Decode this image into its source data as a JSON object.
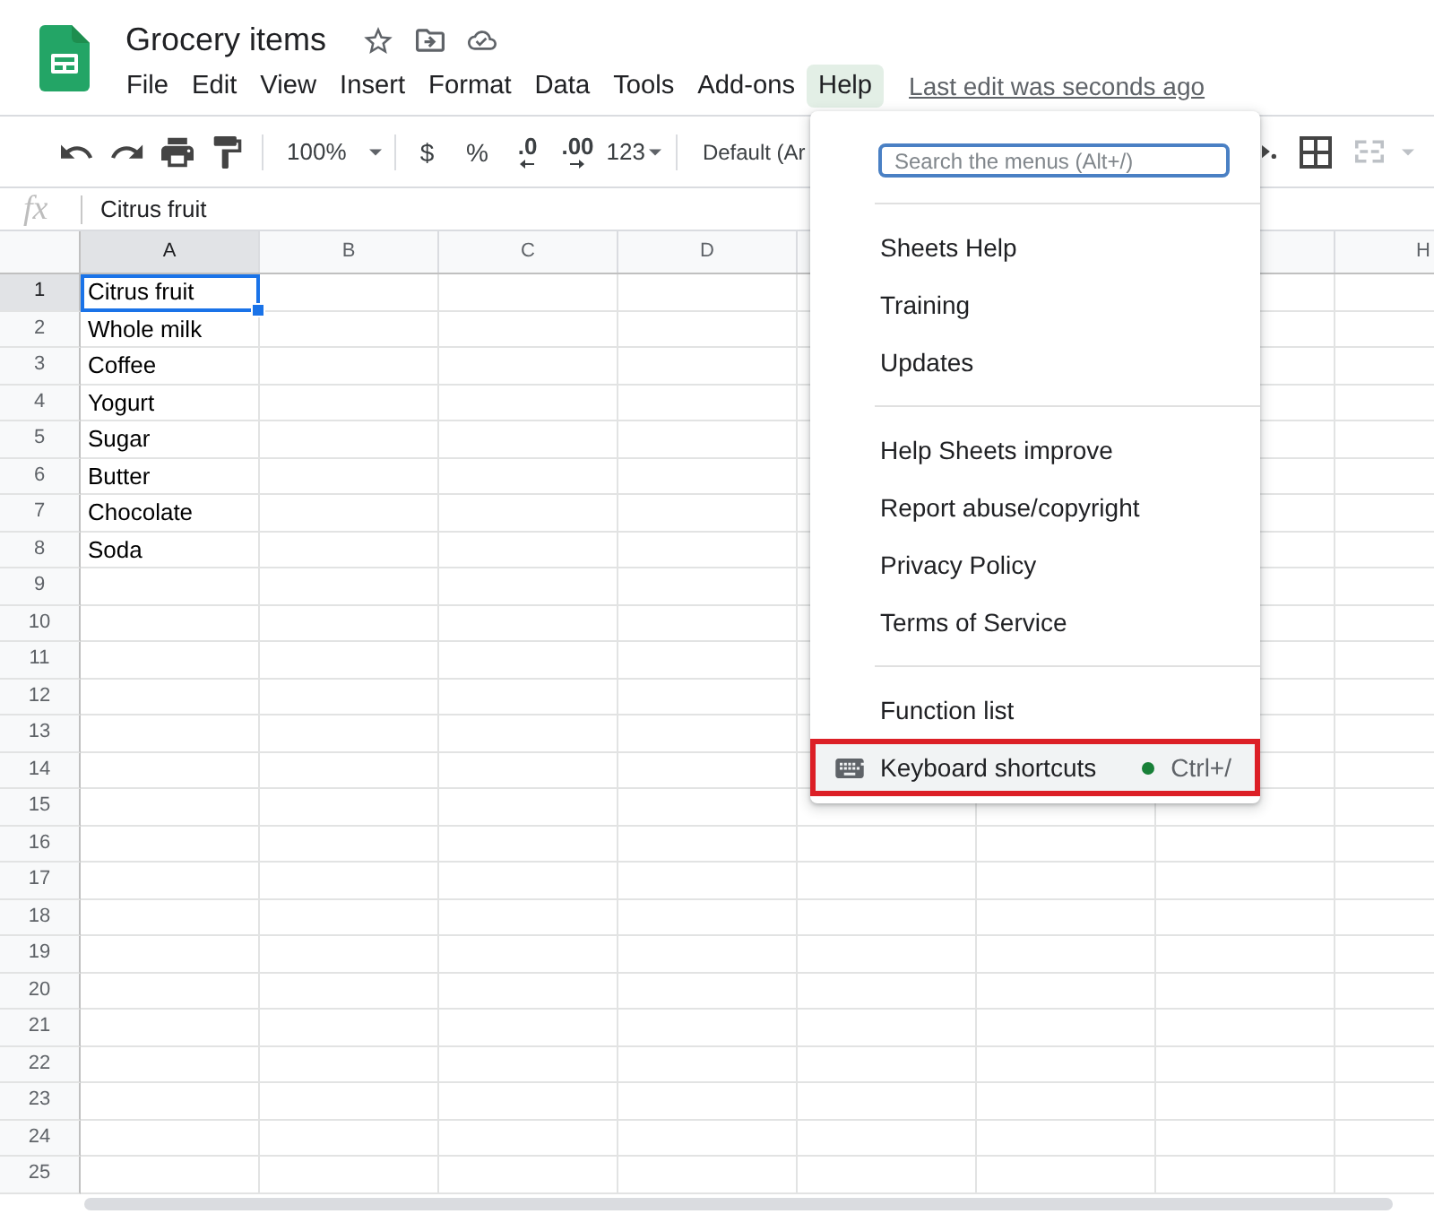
{
  "document": {
    "title": "Grocery items"
  },
  "menubar": {
    "items": [
      {
        "label": "File",
        "selected": false
      },
      {
        "label": "Edit",
        "selected": false
      },
      {
        "label": "View",
        "selected": false
      },
      {
        "label": "Insert",
        "selected": false
      },
      {
        "label": "Format",
        "selected": false
      },
      {
        "label": "Data",
        "selected": false
      },
      {
        "label": "Tools",
        "selected": false
      },
      {
        "label": "Add-ons",
        "selected": false
      },
      {
        "label": "Help",
        "selected": true
      }
    ],
    "last_edit": "Last edit was seconds ago"
  },
  "toolbar": {
    "zoom": "100%",
    "currency": "$",
    "percent": "%",
    "decrease_decimals": ".0",
    "increase_decimals": ".00",
    "number_format": "123",
    "font": "Default (Ar",
    "merge_disabled": true
  },
  "formula_bar": {
    "label": "fx",
    "value": "Citrus fruit"
  },
  "grid": {
    "columns": [
      {
        "label": "A",
        "selected": true
      },
      {
        "label": "B",
        "selected": false
      },
      {
        "label": "C",
        "selected": false
      },
      {
        "label": "D",
        "selected": false
      },
      {},
      {},
      {},
      {
        "label": "H",
        "selected": false
      }
    ],
    "rows": [
      {
        "label": "1",
        "selected": true,
        "cells": [
          {
            "text": "Citrus fruit",
            "selected": true
          }
        ]
      },
      {
        "label": "2",
        "selected": false,
        "cells": [
          {
            "text": "Whole milk",
            "selected": false
          }
        ]
      },
      {
        "label": "3",
        "selected": false,
        "cells": [
          {
            "text": "Coffee",
            "selected": false
          }
        ]
      },
      {
        "label": "4",
        "selected": false,
        "cells": [
          {
            "text": "Yogurt",
            "selected": false
          }
        ]
      },
      {
        "label": "5",
        "selected": false,
        "cells": [
          {
            "text": "Sugar",
            "selected": false
          }
        ]
      },
      {
        "label": "6",
        "selected": false,
        "cells": [
          {
            "text": "Butter",
            "selected": false
          }
        ]
      },
      {
        "label": "7",
        "selected": false,
        "cells": [
          {
            "text": "Chocolate",
            "selected": false
          }
        ]
      },
      {
        "label": "8",
        "selected": false,
        "cells": [
          {
            "text": "Soda",
            "selected": false
          }
        ]
      },
      {
        "label": "9",
        "selected": false
      },
      {
        "label": "10",
        "selected": false
      },
      {
        "label": "11",
        "selected": false
      },
      {
        "label": "12",
        "selected": false
      },
      {
        "label": "13",
        "selected": false
      },
      {
        "label": "14",
        "selected": false
      },
      {
        "label": "15",
        "selected": false
      },
      {
        "label": "16",
        "selected": false
      },
      {
        "label": "17",
        "selected": false
      },
      {
        "label": "18",
        "selected": false
      },
      {
        "label": "19",
        "selected": false
      },
      {
        "label": "20",
        "selected": false
      },
      {
        "label": "21",
        "selected": false
      },
      {
        "label": "22",
        "selected": false
      },
      {
        "label": "23",
        "selected": false
      },
      {
        "label": "24",
        "selected": false
      },
      {
        "label": "25",
        "selected": false
      }
    ]
  },
  "help_menu": {
    "search": {
      "placeholder": "Search the menus (Alt+/)"
    },
    "sections": [
      {
        "items": [
          {
            "label": "Sheets Help",
            "kind": "text",
            "hovered": false,
            "outlined": false,
            "dot": false
          },
          {
            "label": "Training",
            "kind": "text",
            "hovered": false,
            "outlined": false,
            "dot": false
          },
          {
            "label": "Updates",
            "kind": "text",
            "hovered": false,
            "outlined": false,
            "dot": false
          }
        ]
      },
      {
        "items": [
          {
            "label": "Help Sheets improve",
            "kind": "text",
            "hovered": false,
            "outlined": false,
            "dot": false
          },
          {
            "label": "Report abuse/copyright",
            "kind": "text",
            "hovered": false,
            "outlined": false,
            "dot": false
          },
          {
            "label": "Privacy Policy",
            "kind": "text",
            "hovered": false,
            "outlined": false,
            "dot": false
          },
          {
            "label": "Terms of Service",
            "kind": "text",
            "hovered": false,
            "outlined": false,
            "dot": false
          }
        ]
      },
      {
        "items": [
          {
            "label": "Function list",
            "kind": "text",
            "hovered": false,
            "outlined": false,
            "dot": false
          },
          {
            "label": "Keyboard shortcuts",
            "kind": "icon",
            "hovered": true,
            "outlined": true,
            "dot": true,
            "shortcut": "Ctrl+/"
          }
        ]
      }
    ]
  }
}
